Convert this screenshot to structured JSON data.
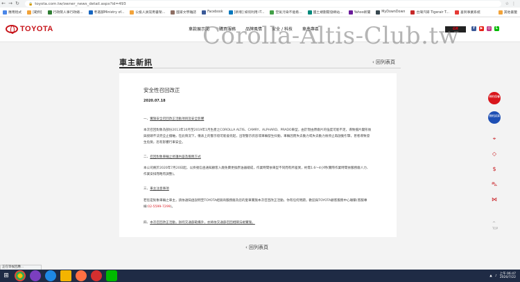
{
  "browser": {
    "url": "toyota.com.tw/owner_news_detail.aspx?id=493",
    "bookmarks": [
      "應用程式",
      "[範例]",
      "行政院人事行政總...",
      "考選部Ministry of...",
      "公投人員常用書架...",
      "國家文學雜誌",
      "Facebook",
      "[新增] 如何利用 iT...",
      "空氣污染不能看...",
      "國土規劃開發網站...",
      "Yahoo新聞",
      "MyDownDown",
      "台灣汽研 Tigerair T...",
      "喜到事業系統"
    ],
    "bookmarks_right": "其他書籤"
  },
  "site": {
    "brand": "TOYOTA",
    "nav": [
      "車款展示間",
      "購買服務",
      "品牌風情",
      "安全 / 科技",
      "車主專區"
    ],
    "gr_badge": "GR",
    "gr_badge_rest": "RACING",
    "social": [
      "f",
      "▶",
      "◎",
      "L"
    ],
    "watermark": "Corolla-Altis-Club.tw"
  },
  "section": {
    "title": "車主新訊",
    "back_label": "回列表頁"
  },
  "article": {
    "title": "安全性召回改正",
    "date": "2020.07.18",
    "h1_prefix": "一、",
    "h1": "實施安全召回改正活動項目及安全影響",
    "p1": "本次召回對象為部份2013年10月至2019年1月生產之COROLLA ALTIS、CAMRY、ALPHARD、PRADO車型，由於現由原廠片的強度可能不足，導致擋片變形後與接頭不法完全止擋軸，在此情況下，儀表上的警示燈可能會亮起，出現警示訊息或車輛發生抖動，車輛因而失去動力或失去動力後停止再啟動引擎，甚者導致發生危險，恐有影響行車安全。",
    "h2_prefix": "二、",
    "h2": "召回對象車輛之修護內容及服務方式",
    "p2": "本公司將於2020年7月20日起，以掛號信函通知顧客入廠免費更換原油器總成，作業時間依車型不同而有所差異，約需1.6～4小時(實際作業時間依服務廠人力、作業安排而略有調整)。",
    "h3_prefix": "三、",
    "h3": "車主注意事項",
    "p3a": "若您是對象車輛之車主，請依通知函說明至TOYOTA經銷商服務廠為您的愛車實施本次召回改正活動，你有任何問題，歡迎與TOYOTA顧客服務中心聯繫(客服專線:",
    "p3_phone": "02-5599-7299",
    "p3b": ")。",
    "h4_prefix": "四、",
    "h4": "本次召回改正活動，辦何交通部範備外，亦將依交通部召回相關法規實施。"
  },
  "floating": {
    "btn1_label": "預約保養",
    "btn2_label": "預約試乘",
    "side_icons": [
      "location-pin-icon",
      "tag-icon",
      "dollar-icon",
      "car-icon",
      "share-icon"
    ],
    "top_label": "TOP"
  },
  "status_text": "正在等候回應...",
  "taskbar": {
    "time": "上午 06:47",
    "date": "2020/7/22"
  },
  "colors": {
    "toyota_red": "#c7141a",
    "taskbar": "#1f2b45"
  }
}
